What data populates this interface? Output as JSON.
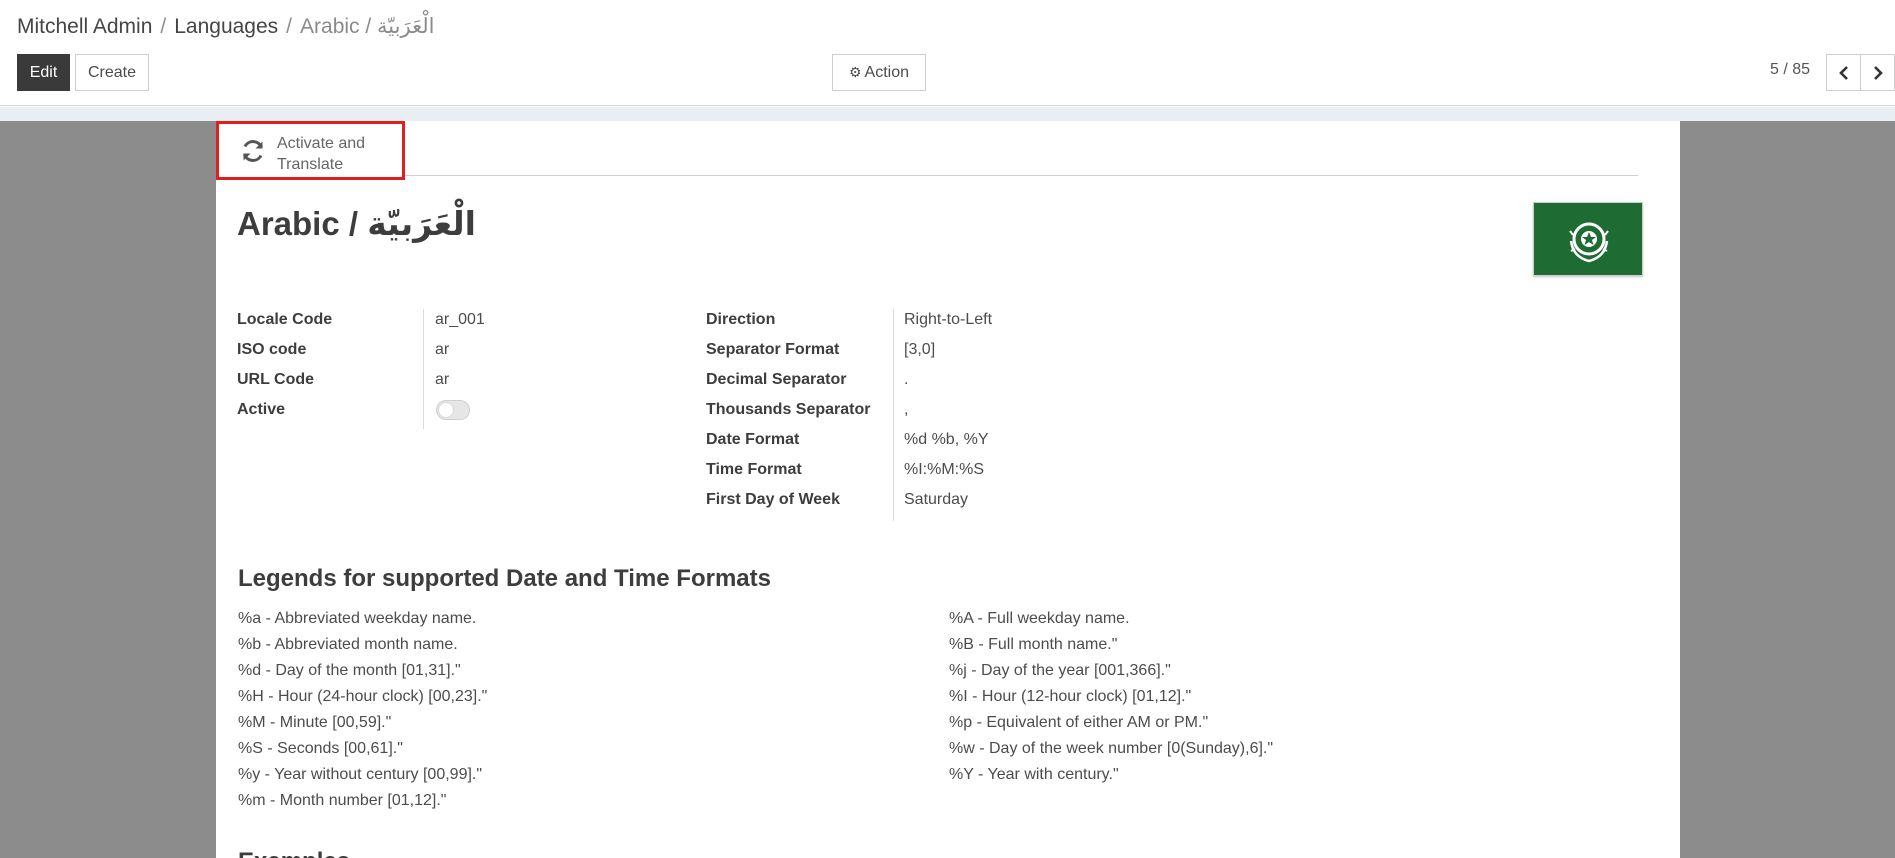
{
  "breadcrumb": {
    "items": [
      "Mitchell Admin",
      "Languages"
    ],
    "current": "Arabic / الْعَرَبيّة",
    "separator": "/"
  },
  "toolbar": {
    "edit_label": "Edit",
    "create_label": "Create",
    "action_label": "Action",
    "action_icon": "gear-icon"
  },
  "pager": {
    "value": "5 / 85",
    "prev_icon": "chevron-left-icon",
    "next_icon": "chevron-right-icon"
  },
  "statusbar": {
    "activate_label": "Activate and Translate",
    "activate_icon": "refresh-icon",
    "highlight_color": "#e0201f"
  },
  "record": {
    "title": "Arabic / الْعَرَبيّة",
    "flag_icon": "arab-league-flag",
    "flag_color": "#1e6b33"
  },
  "fields_left": [
    {
      "label": "Locale Code",
      "value": "ar_001"
    },
    {
      "label": "ISO code",
      "value": "ar"
    },
    {
      "label": "URL Code",
      "value": "ar"
    },
    {
      "label": "Active",
      "value": ""
    }
  ],
  "active_toggle": {
    "checked": false
  },
  "fields_right": [
    {
      "label": "Direction",
      "value": "Right-to-Left"
    },
    {
      "label": "Separator Format",
      "value": "[3,0]"
    },
    {
      "label": "Decimal Separator",
      "value": "."
    },
    {
      "label": "Thousands Separator",
      "value": ","
    },
    {
      "label": "Date Format",
      "value": "%d %b, %Y"
    },
    {
      "label": "Time Format",
      "value": "%I:%M:%S"
    },
    {
      "label": "First Day of Week",
      "value": "Saturday"
    }
  ],
  "legends": {
    "title": "Legends for supported Date and Time Formats",
    "left": [
      "%a - Abbreviated weekday name.",
      "%b - Abbreviated month name.",
      "%d - Day of the month [01,31].\"",
      "%H - Hour (24-hour clock) [00,23].\"",
      "%M - Minute [00,59].\"",
      "%S - Seconds [00,61].\"",
      "%y - Year without century [00,99].\"",
      "%m - Month number [01,12].\""
    ],
    "right": [
      "%A - Full weekday name.",
      "%B - Full month name.\"",
      "%j - Day of the year [001,366].\"",
      "%I - Hour (12-hour clock) [01,12].\"",
      "%p - Equivalent of either AM or PM.\"",
      "%w - Day of the week number [0(Sunday),6].\"",
      "%Y - Year with century.\""
    ]
  },
  "examples": {
    "title": "Examples"
  }
}
